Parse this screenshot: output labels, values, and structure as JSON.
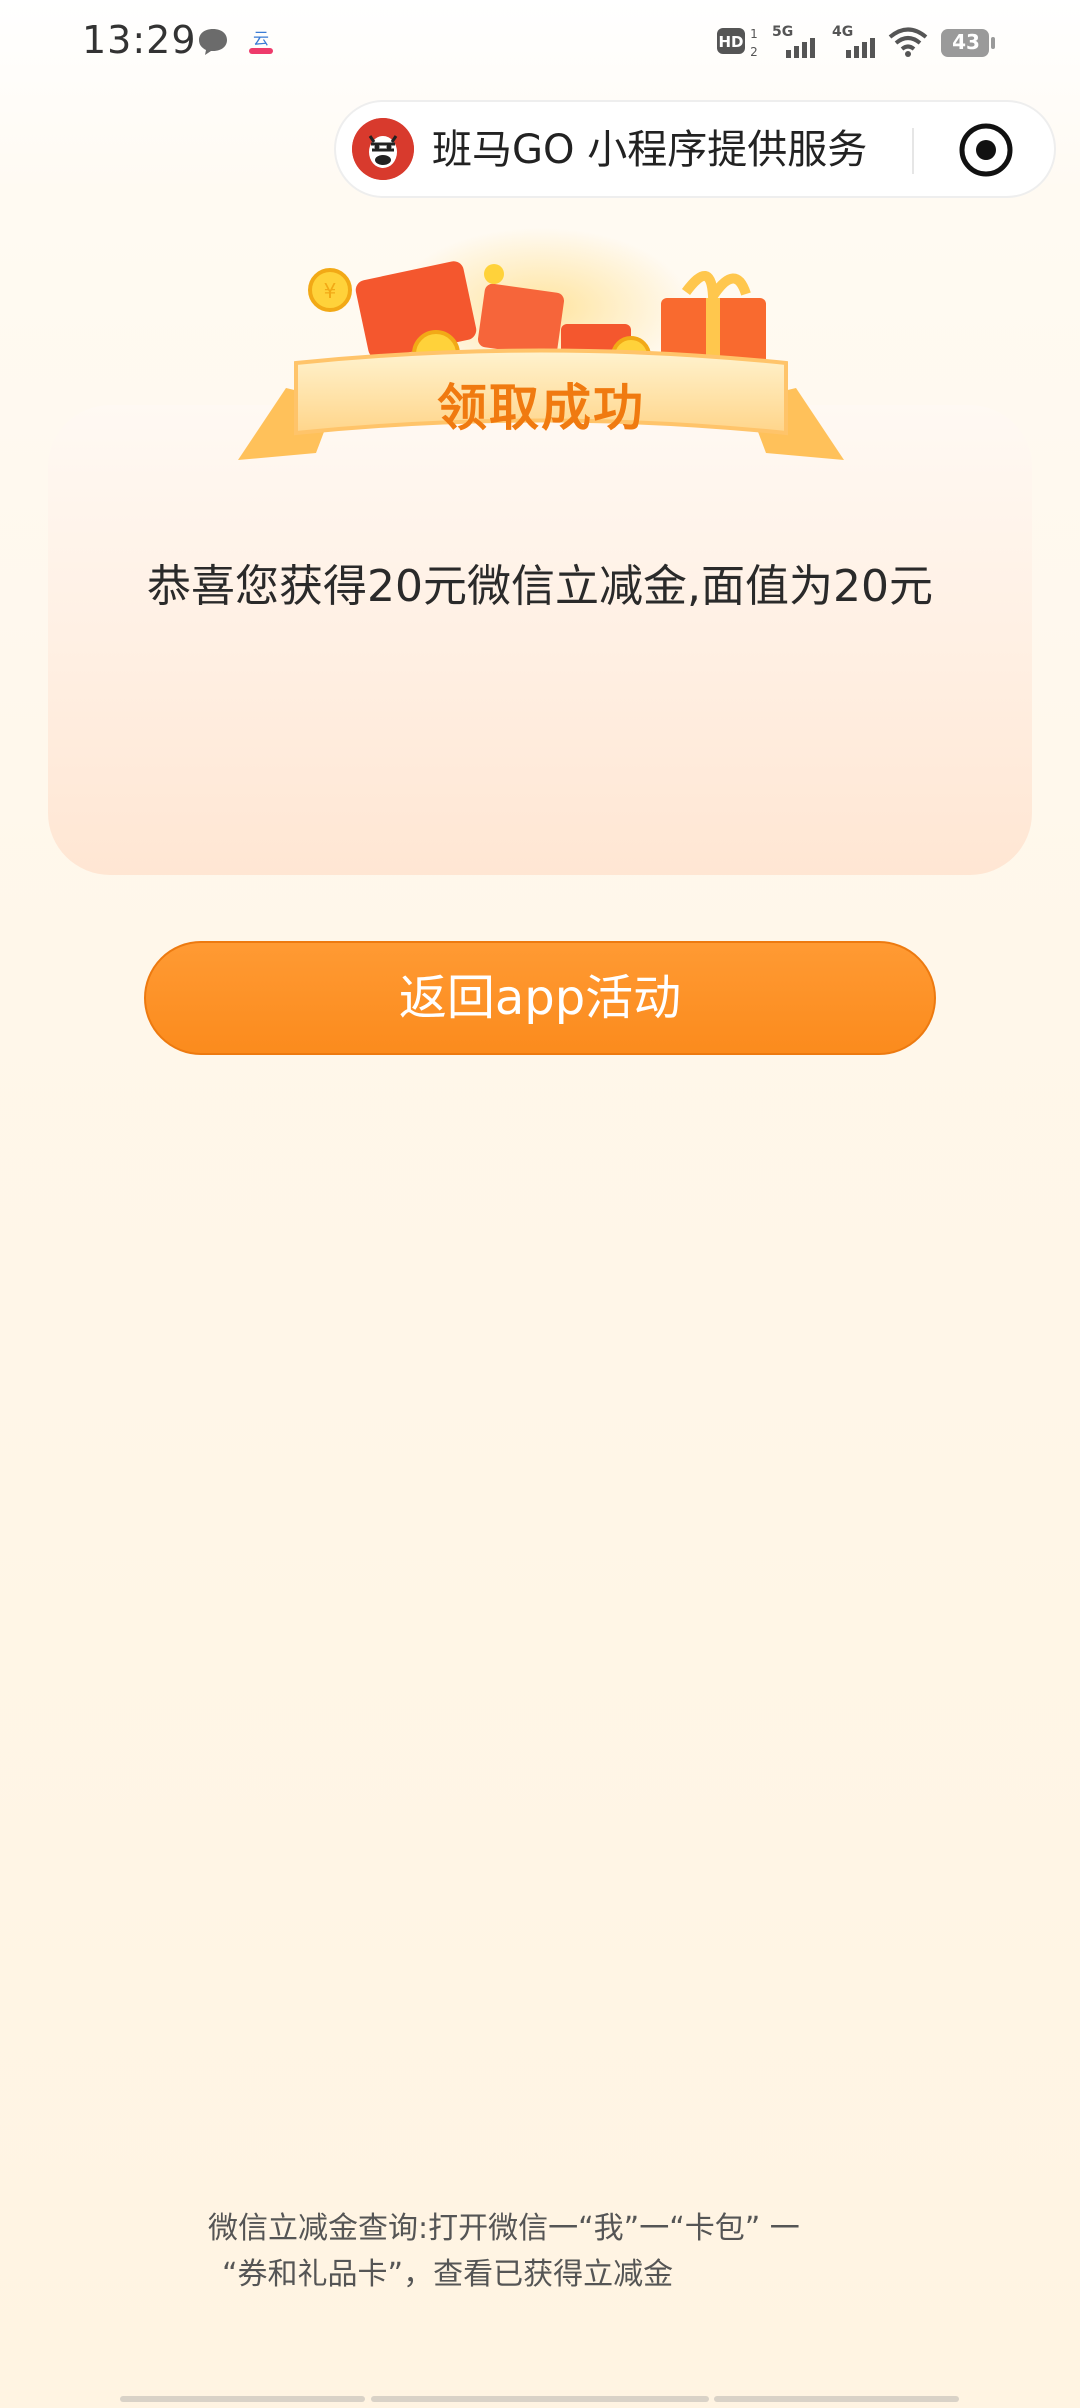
{
  "status_bar": {
    "time": "13:29",
    "battery": "43",
    "network_1": "5G",
    "network_2": "4G",
    "hd": "HD"
  },
  "capsule": {
    "title": "班马GO 小程序提供服务"
  },
  "card": {
    "banner_title": "领取成功",
    "message": "恭喜您获得20元微信立减金,面值为20元"
  },
  "actions": {
    "back_button": "返回app活动"
  },
  "tips": {
    "line_1": "微信立减金查询:打开微信一“我”一“卡包” 一",
    "line_2": "“券和礼品卡”，查看已获得立减金"
  },
  "colors": {
    "accent": "#fb8b1d",
    "banner_text": "#f07a10",
    "avatar": "#d83a2d"
  }
}
